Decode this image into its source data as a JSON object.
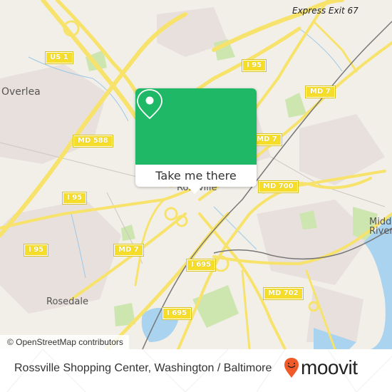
{
  "map": {
    "place_labels": {
      "rossville": "Rossville",
      "overlea": "Overlea",
      "rosedale": "Rosedale",
      "middle_river_1": "Middle",
      "middle_river_2": "River"
    },
    "exit_label": "Express Exit 67",
    "route_shields": {
      "us1": "US 1",
      "i95_top": "I 95",
      "md7_top": "MD 7",
      "md588": "MD 588",
      "md7_mid": "MD 7",
      "i95_mid": "I 95",
      "md700": "MD 700",
      "i95_left": "I 95",
      "md7_low": "MD 7",
      "i695_a": "I 695",
      "i695_b": "I 695",
      "md702": "MD 702"
    },
    "attribution": "© OpenStreetMap contributors",
    "colors": {
      "land": "#f2efe9",
      "road": "#f7e36b",
      "park": "#cde6b0",
      "water": "#a9d3ef",
      "rail": "#777777"
    }
  },
  "popup": {
    "button_label": "Take me there",
    "accent_color": "#1fb866"
  },
  "footer": {
    "title": "Rossville Shopping Center, Washington / Baltimore",
    "brand": "moovit",
    "brand_color": "#f05a28"
  }
}
